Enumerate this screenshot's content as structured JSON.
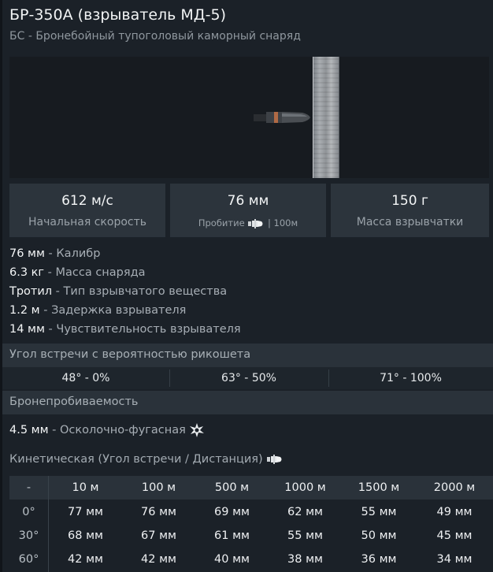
{
  "header": {
    "title": "БР-350А (взрыватель МД-5)",
    "subtitle": "БС - Бронебойный тупоголовый каморный снаряд"
  },
  "stats": {
    "velocity_value": "612 м/с",
    "velocity_label": "Начальная скорость",
    "penetration_value": "76 мм",
    "penetration_label": "Пробитие",
    "penetration_range": "| 100м",
    "explosive_value": "150 г",
    "explosive_label": "Масса взрывчатки"
  },
  "properties": [
    {
      "value": "76 мм",
      "desc": "Калибр"
    },
    {
      "value": "6.3 кг",
      "desc": "Масса снаряда"
    },
    {
      "value": "Тротил",
      "desc": "Тип взрывчатого вещества"
    },
    {
      "value": "1.2 м",
      "desc": "Задержка взрывателя"
    },
    {
      "value": "14 мм",
      "desc": "Чувствительность взрывателя"
    }
  ],
  "ricochet": {
    "heading": "Угол встречи с вероятностью рикошета",
    "cells": [
      "48° - 0%",
      "63° - 50%",
      "71° - 100%"
    ]
  },
  "armor": {
    "heading": "Бронепробиваемость",
    "frag_value": "4.5 мм",
    "frag_desc": "Осколочно-фугасная",
    "kinetic_heading": "Кинетическая (Угол встречи / Дистанция)"
  },
  "pen_table": {
    "columns": [
      "-",
      "10 м",
      "100 м",
      "500 м",
      "1000 м",
      "1500 м",
      "2000 м"
    ],
    "rows": [
      {
        "angle": "0°",
        "values": [
          "77 мм",
          "76 мм",
          "69 мм",
          "62 мм",
          "55 мм",
          "49 мм"
        ]
      },
      {
        "angle": "30°",
        "values": [
          "68 мм",
          "67 мм",
          "61 мм",
          "55 мм",
          "50 мм",
          "45 мм"
        ]
      },
      {
        "angle": "60°",
        "values": [
          "42 мм",
          "42 мм",
          "40 мм",
          "38 мм",
          "36 мм",
          "34 мм"
        ]
      }
    ]
  },
  "icons": {
    "penetration": "shell-icon",
    "fragmentation": "explosion-icon",
    "kinetic": "shell-icon"
  }
}
